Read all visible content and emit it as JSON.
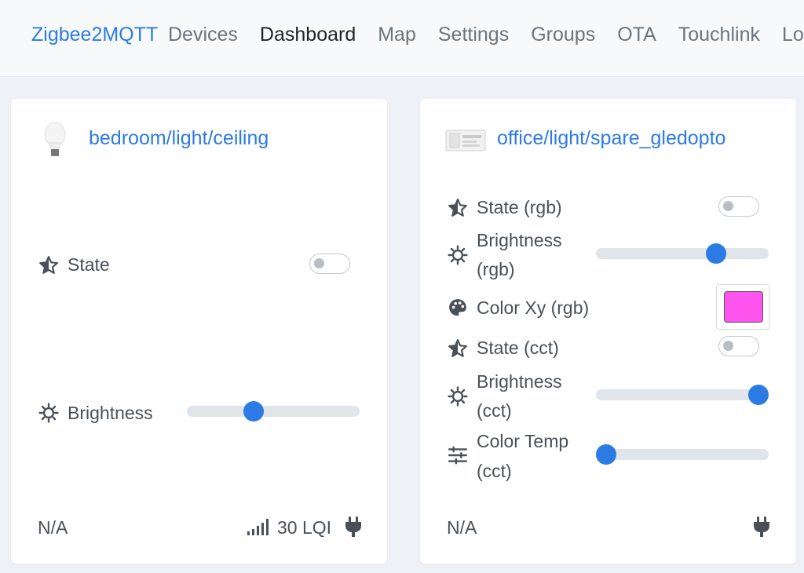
{
  "nav": {
    "brand": "Zigbee2MQTT",
    "links": [
      "Devices",
      "Dashboard",
      "Map",
      "Settings",
      "Groups",
      "OTA",
      "Touchlink",
      "Logs"
    ],
    "active": "Dashboard"
  },
  "cards": [
    {
      "device": "bedroom/light/ceiling",
      "icon": "light-bulb-icon",
      "rows": {
        "state": {
          "label": "State",
          "value": "off"
        },
        "brightness": {
          "label": "Brightness",
          "value_fraction": 0.37
        }
      },
      "footer": {
        "last_seen": "N/A",
        "lqi": "30 LQI",
        "power_icon": "plug-icon"
      }
    },
    {
      "device": "office/light/spare_gledopto",
      "icon": "led-controller-icon",
      "rows": {
        "state_rgb": {
          "label": "State (rgb)",
          "value": "off"
        },
        "brightness_rgb": {
          "label1": "Brightness",
          "label2": "(rgb)",
          "value_fraction": 0.72
        },
        "color_xy_rgb": {
          "label": "Color Xy (rgb)",
          "color": "#ff55ee"
        },
        "state_cct": {
          "label": "State (cct)",
          "value": "off"
        },
        "brightness_cct": {
          "label1": "Brightness",
          "label2": "(cct)",
          "value_fraction": 1.0
        },
        "color_temp_cct": {
          "label1": "Color Temp",
          "label2": "(cct)",
          "value_fraction": 0.0
        }
      },
      "footer": {
        "last_seen": "N/A",
        "power_icon": "plug-icon"
      }
    }
  ],
  "colors": {
    "accent": "#2c7be5",
    "track": "#dfe5ea"
  }
}
